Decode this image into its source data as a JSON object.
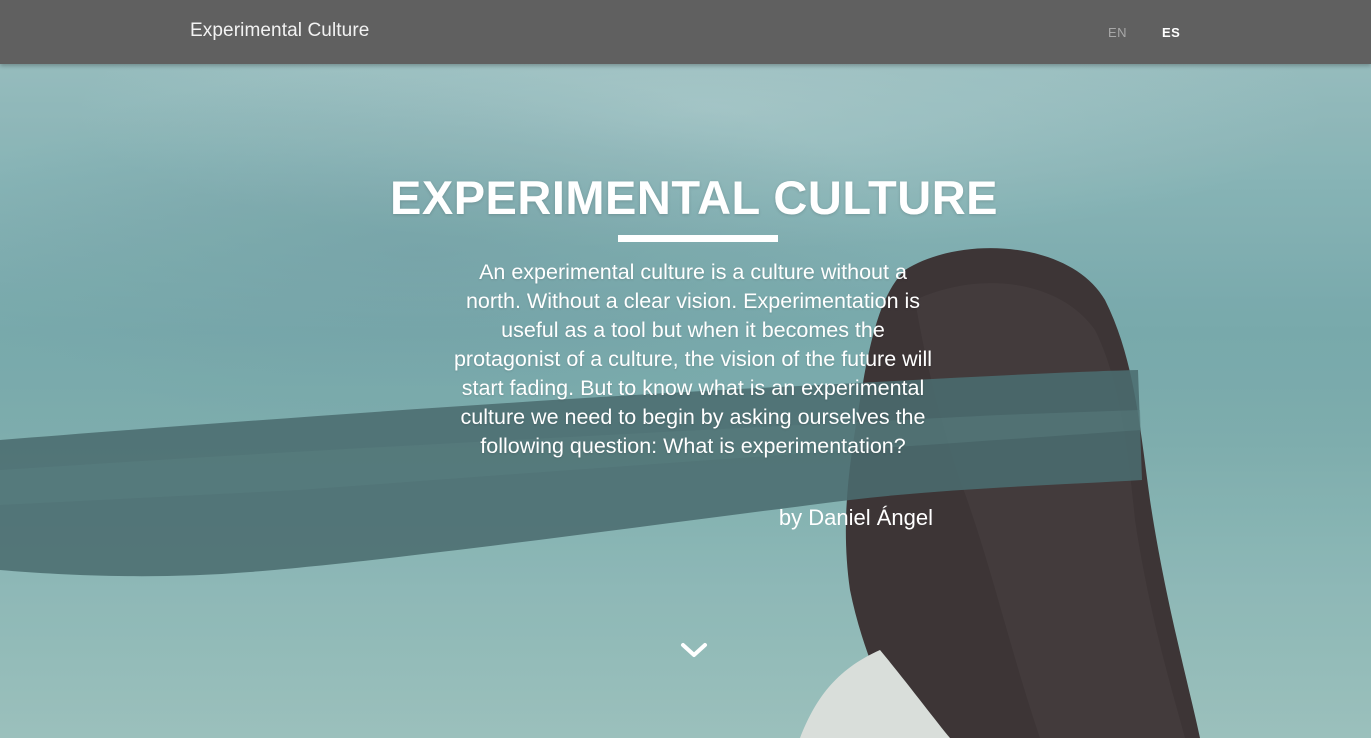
{
  "navbar": {
    "brand": "Experimental Culture",
    "languages": [
      {
        "code": "EN",
        "active": false
      },
      {
        "code": "ES",
        "active": true
      }
    ]
  },
  "hero": {
    "title": "EXPERIMENTAL CULTURE",
    "text": "An experimental culture is a culture without a north. Without a clear vision. Experimentation is useful as a tool but when it becomes the protagonist of a culture, the vision of the future will start fading. But to know what is an experimental culture we need to begin by asking ourselves the following question: What is experimentation?",
    "author": "by Daniel Ángel",
    "scroll_icon": "chevron-down-icon"
  },
  "colors": {
    "navbar_bg": "#606060",
    "text_white": "#ffffff",
    "inactive_lang": "#a8a8a8",
    "sky_teal": "#8fbdbe"
  }
}
